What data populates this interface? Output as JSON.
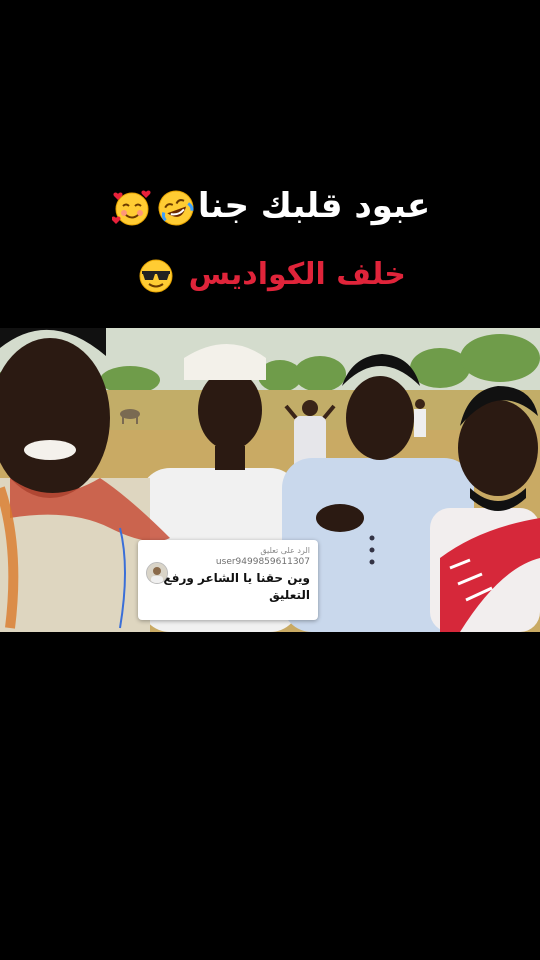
{
  "caption": {
    "line1_text": "عبود قلبك جنا",
    "line1_emojis": [
      "rolling-laughing-emoji",
      "smiling-hearts-emoji"
    ],
    "line2_text": "خلف الكواديس",
    "line2_emoji": "sunglasses-emoji",
    "line1_color": "#ffffff",
    "line2_color": "#e0243a"
  },
  "reply": {
    "header": "الرد على تعليق",
    "username": "user9499859611307",
    "comment": "وين حقنا يا الشاعر ورفع التعليق"
  }
}
